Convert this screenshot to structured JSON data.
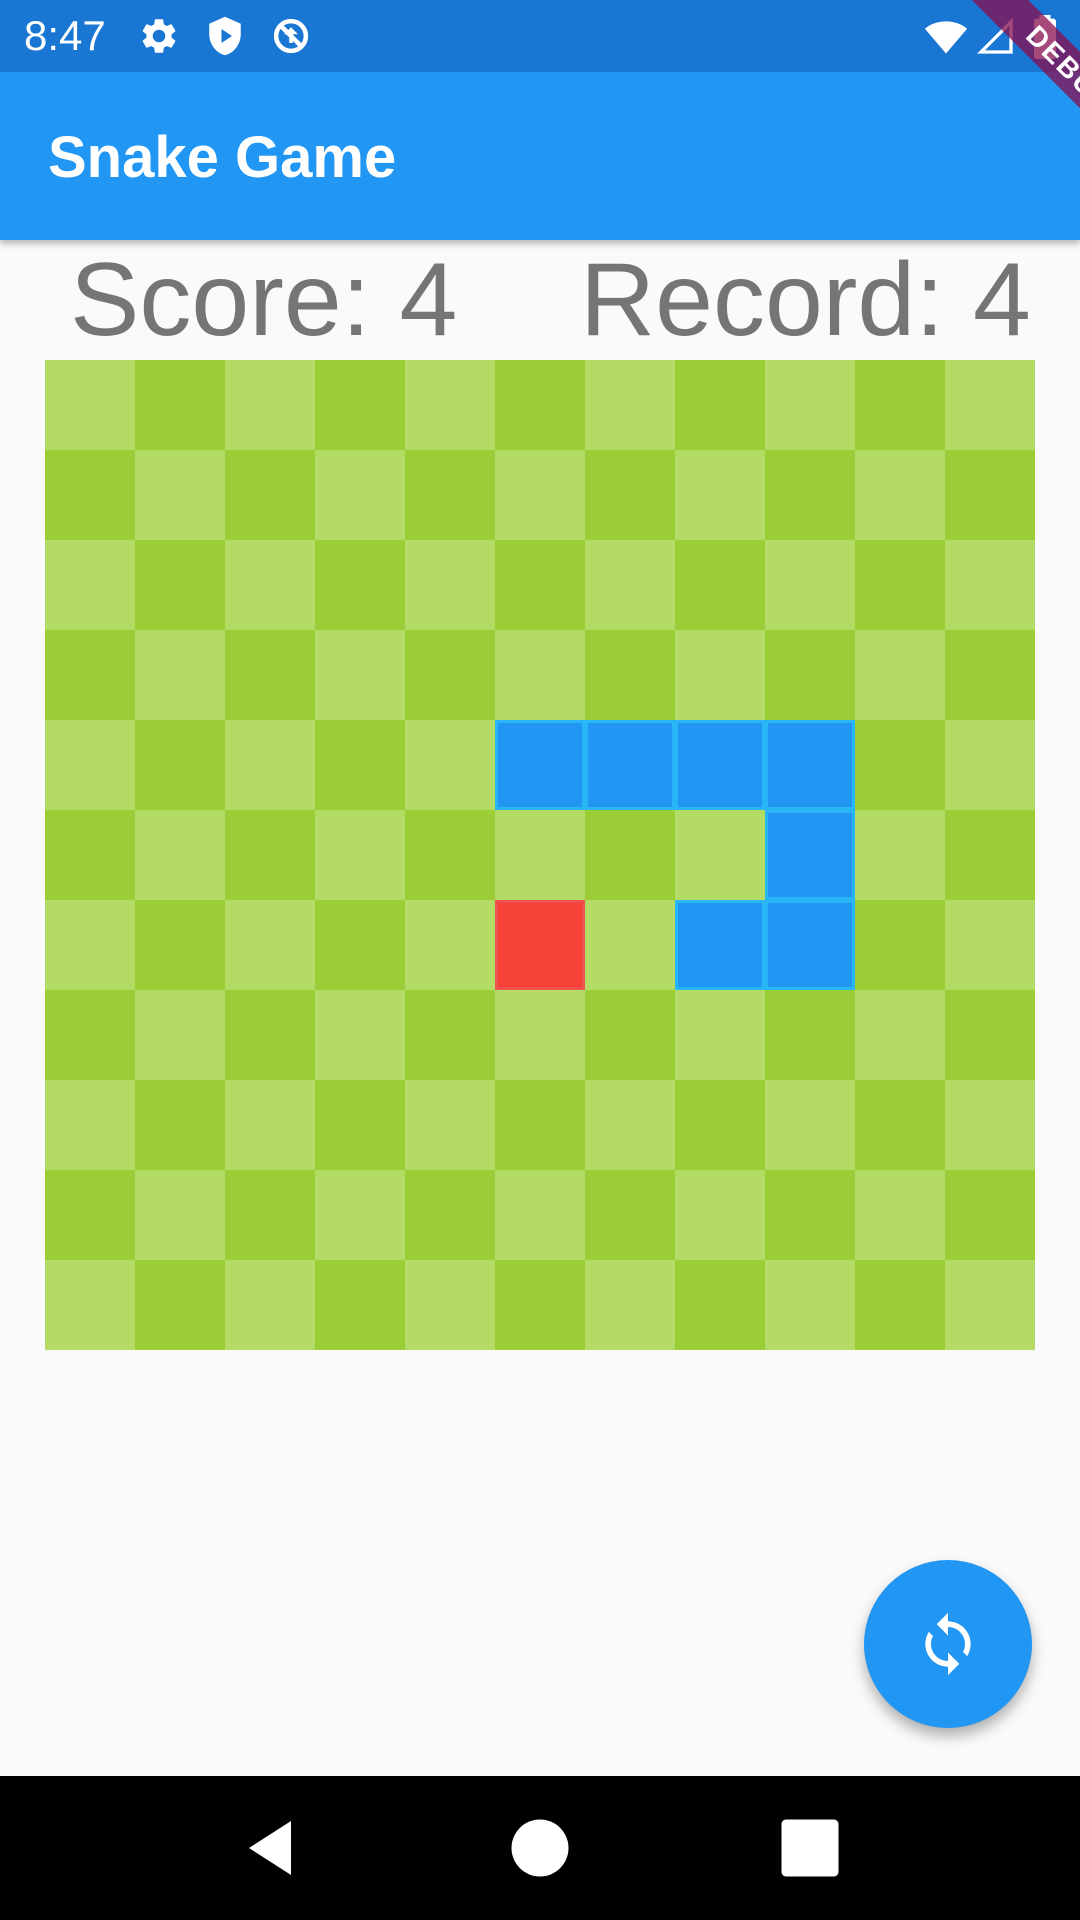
{
  "status_bar": {
    "time": "8:47",
    "left_icons": [
      "gear-icon",
      "play-protect-icon",
      "sync-off-icon"
    ],
    "right_icons": [
      "wifi-icon",
      "signal-icon",
      "battery-icon"
    ]
  },
  "app_bar": {
    "title": "Snake Game",
    "color": "#2196F3"
  },
  "debug_banner": {
    "label": "DEBUG"
  },
  "scoreboard": {
    "score_text": "Score: 4",
    "record_text": "Record: 4"
  },
  "game": {
    "rows": 11,
    "cols": 11,
    "light_color": "#B3DB66",
    "dark_color": "#9ACD36",
    "snake_color": "#2196F3",
    "snake_border_color": "#29B6F6",
    "food_color": "#F44336",
    "food_border_color": "#EF5350",
    "snake": [
      [
        4,
        5
      ],
      [
        4,
        6
      ],
      [
        4,
        7
      ],
      [
        4,
        8
      ],
      [
        5,
        8
      ],
      [
        6,
        8
      ],
      [
        6,
        7
      ]
    ],
    "food": [
      6,
      5
    ]
  },
  "fab": {
    "icon": "refresh-icon",
    "color": "#2196F3"
  },
  "nav_bar": {
    "buttons": [
      "back-icon",
      "home-icon",
      "recents-icon"
    ]
  }
}
